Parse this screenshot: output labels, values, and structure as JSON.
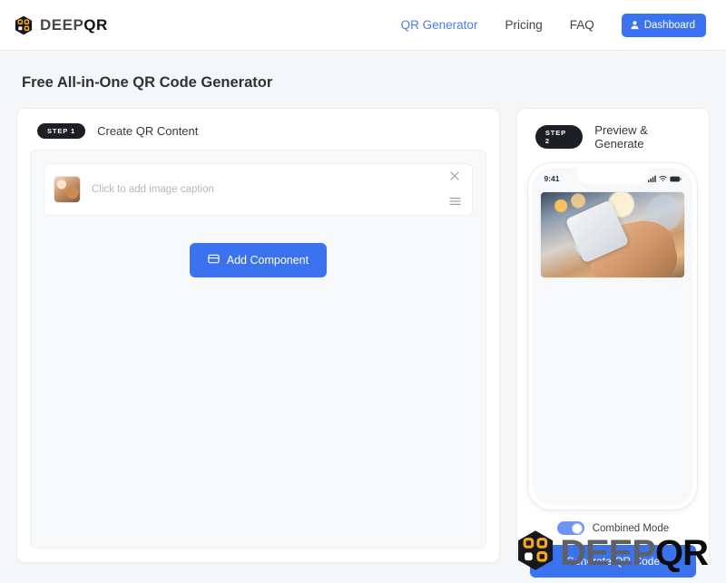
{
  "brand": {
    "deep": "DEEP",
    "qr": "QR",
    "icon": "hexagon-qr-logo-icon"
  },
  "nav": {
    "links": [
      {
        "label": "QR Generator",
        "active": true
      },
      {
        "label": "Pricing",
        "active": false
      },
      {
        "label": "FAQ",
        "active": false
      }
    ],
    "dashboard_label": "Dashboard",
    "dashboard_icon": "user-icon",
    "accent_color": "#3b72f0",
    "active_link_color": "#4a7df5"
  },
  "page": {
    "title": "Free All-in-One QR Code Generator"
  },
  "left_panel": {
    "step_badge": "STEP 1",
    "step_title": "Create QR Content",
    "component": {
      "thumbnail_icon": "image-thumbnail",
      "caption_placeholder": "Click to add image caption",
      "caption_value": "",
      "close_icon": "close-icon",
      "drag_icon": "drag-handle-icon"
    },
    "add_button": {
      "label": "Add Component",
      "icon": "add-component-icon"
    }
  },
  "right_panel": {
    "step_badge": "STEP 2",
    "step_title": "Preview & Generate",
    "phone": {
      "status_time": "9:41",
      "signal_icon": "signal-bars-icon",
      "wifi_icon": "wifi-icon",
      "battery_icon": "battery-icon",
      "preview_image_alt": "hands-holding-smartphone-photo"
    },
    "toggle": {
      "label": "Combined Mode",
      "state": "on",
      "on_color": "#6f93f4"
    },
    "generate_button": {
      "label": "Generate QR Code"
    }
  },
  "watermark": {
    "deep": "DEEP",
    "qr": "QR",
    "icon": "hexagon-qr-logo-icon"
  }
}
